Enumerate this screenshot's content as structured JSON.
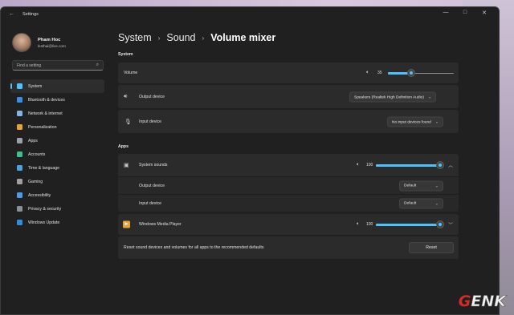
{
  "window": {
    "title": "Settings",
    "controls": {
      "minimize": "—",
      "maximize": "□",
      "close": "✕"
    }
  },
  "profile": {
    "name": "Pham Hoc",
    "email": "lesthai@live.com"
  },
  "search": {
    "placeholder": "Find a setting"
  },
  "sidebar": {
    "items": [
      {
        "label": "System",
        "icon": "system-icon",
        "color": "#4cc2ff",
        "active": true
      },
      {
        "label": "Bluetooth & devices",
        "icon": "bluetooth-icon",
        "color": "#3a8ee6"
      },
      {
        "label": "Network & internet",
        "icon": "network-icon",
        "color": "#7fb5e8"
      },
      {
        "label": "Personalization",
        "icon": "brush-icon",
        "color": "#e8a23a"
      },
      {
        "label": "Apps",
        "icon": "apps-icon",
        "color": "#9aa0a6"
      },
      {
        "label": "Accounts",
        "icon": "account-icon",
        "color": "#3fbf8f"
      },
      {
        "label": "Time & language",
        "icon": "clock-icon",
        "color": "#4aa3df"
      },
      {
        "label": "Gaming",
        "icon": "gaming-icon",
        "color": "#a0a0a0"
      },
      {
        "label": "Accessibility",
        "icon": "accessibility-icon",
        "color": "#4c9be8"
      },
      {
        "label": "Privacy & security",
        "icon": "shield-icon",
        "color": "#8a8f98"
      },
      {
        "label": "Windows Update",
        "icon": "update-icon",
        "color": "#2f8ce0"
      }
    ]
  },
  "breadcrumb": {
    "level1": "System",
    "level2": "Sound",
    "current": "Volume mixer",
    "separator": "›"
  },
  "system_section": {
    "heading": "System",
    "volume": {
      "label": "Volume",
      "value": "35",
      "level": 0.35
    },
    "output": {
      "label": "Output device",
      "selected": "Speakers (Realtek High Definition Audio)"
    },
    "input": {
      "label": "Input device",
      "selected": "No input devices found"
    }
  },
  "apps_section": {
    "heading": "Apps",
    "system_sounds": {
      "label": "System sounds",
      "value": "100",
      "level": 1.0,
      "output": {
        "label": "Output device",
        "selected": "Default"
      },
      "input": {
        "label": "Input device",
        "selected": "Default"
      }
    },
    "media_player": {
      "label": "Windows Media Player",
      "value": "100",
      "level": 1.0
    },
    "reset": {
      "label": "Reset sound devices and volumes for all apps to the recommended defaults",
      "button": "Reset"
    }
  },
  "watermark": {
    "first": "G",
    "rest": "ENK"
  },
  "colors": {
    "accent": "#4cc2ff",
    "background": "#202020",
    "card": "#2b2b2b"
  }
}
